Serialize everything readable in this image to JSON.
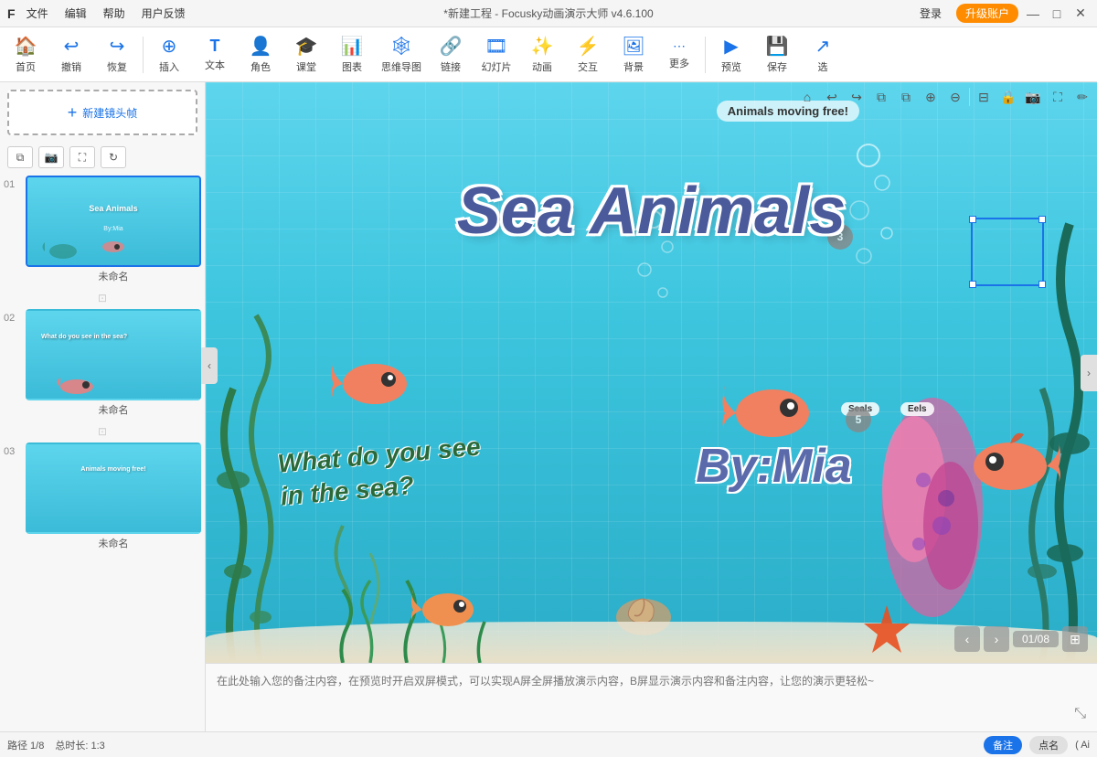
{
  "app": {
    "logo": "F",
    "title": "*新建工程 - Focusky动画演示大师  v4.6.100",
    "login": "登录",
    "upgrade": "升级账户"
  },
  "menu": {
    "items": [
      "文件",
      "编辑",
      "帮助",
      "用户反馈"
    ]
  },
  "toolbar": {
    "items": [
      {
        "id": "home",
        "icon": "🏠",
        "label": "首页"
      },
      {
        "id": "undo",
        "icon": "↩",
        "label": "撤销"
      },
      {
        "id": "redo",
        "icon": "↪",
        "label": "恢复"
      },
      {
        "id": "sep1",
        "type": "sep"
      },
      {
        "id": "insert",
        "icon": "➕",
        "label": "插入"
      },
      {
        "id": "text",
        "icon": "T",
        "label": "文本"
      },
      {
        "id": "role",
        "icon": "👤",
        "label": "角色"
      },
      {
        "id": "class",
        "icon": "🎓",
        "label": "课堂"
      },
      {
        "id": "chart",
        "icon": "📊",
        "label": "图表"
      },
      {
        "id": "mindmap",
        "icon": "🕸",
        "label": "思维导图"
      },
      {
        "id": "link",
        "icon": "🔗",
        "label": "链接"
      },
      {
        "id": "slide",
        "icon": "🎞",
        "label": "幻灯片"
      },
      {
        "id": "anim",
        "icon": "✨",
        "label": "动画"
      },
      {
        "id": "interact",
        "icon": "☰",
        "label": "交互"
      },
      {
        "id": "bg",
        "icon": "🖼",
        "label": "背景"
      },
      {
        "id": "more",
        "icon": "···",
        "label": "更多"
      },
      {
        "id": "sep2",
        "type": "sep"
      },
      {
        "id": "preview",
        "icon": "▶",
        "label": "预览"
      },
      {
        "id": "save",
        "icon": "💾",
        "label": "保存"
      },
      {
        "id": "select",
        "icon": "↗",
        "label": "选"
      }
    ]
  },
  "slides": [
    {
      "num": "01",
      "label": "未命名",
      "title": "Sea Animals",
      "sub": "By:Mia",
      "active": true
    },
    {
      "num": "02",
      "label": "未命名",
      "title": "What do you see\nin the sea?",
      "active": false
    },
    {
      "num": "03",
      "label": "未命名",
      "title": "Animals moving free!",
      "active": false
    }
  ],
  "canvas": {
    "title": "Sea Animals",
    "byline": "By:Mia",
    "question": "What do you see\nin the sea?",
    "animals_free": "Animals moving free!",
    "seals_label": "Seals",
    "eels_label": "Eels",
    "num3": "3",
    "num5": "5",
    "page_info": "01/08"
  },
  "frame_actions": {
    "copy": "复制帧",
    "new_frame": "新建镜头帧"
  },
  "notes": {
    "placeholder": "在此处输入您的备注内容，在预览时开启双屏模式，可以实现A屏全屏播放演示内容，B屏显示演示内容和备注内容，让您的演示更轻松~"
  },
  "status": {
    "path": "路径 1/8",
    "duration": "总时长: 1:3"
  },
  "footer_btns": {
    "notes": "备注",
    "callout": "点名"
  },
  "window_controls": {
    "minimize": "—",
    "maximize": "□",
    "close": "✕"
  }
}
